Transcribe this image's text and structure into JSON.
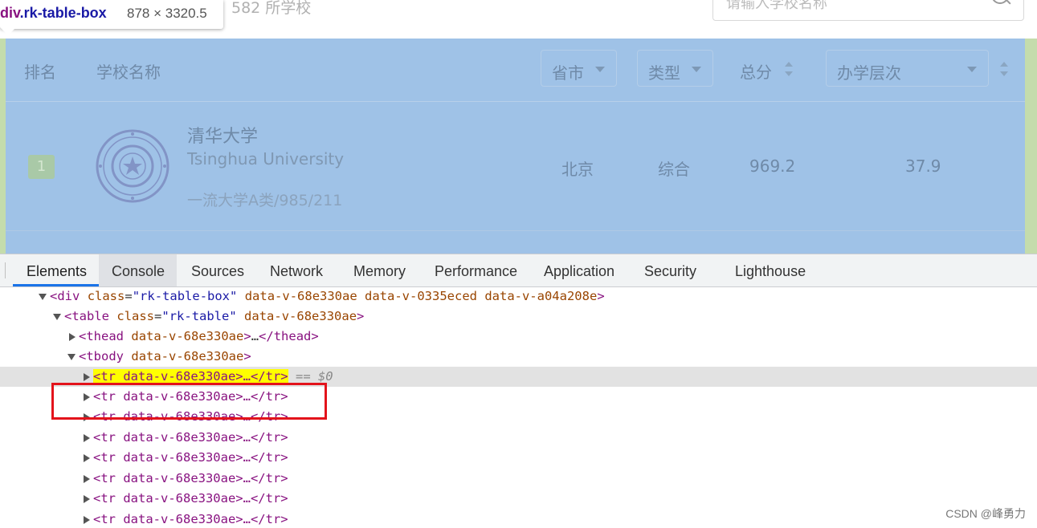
{
  "page": {
    "school_count": "582 所学校",
    "search_placeholder": "请输入学校名称",
    "tooltip": {
      "tag": "div",
      "class": ".rk-table-box",
      "size": "878 × 3320.5"
    },
    "headers": {
      "rank": "排名",
      "name": "学校名称",
      "province": "省市",
      "type": "类型",
      "score": "总分",
      "level": "办学层次"
    },
    "row": {
      "rank": "1",
      "name_cn": "清华大学",
      "name_en": "Tsinghua University",
      "tags": "一流大学A类/985/211",
      "province": "北京",
      "type": "综合",
      "score": "969.2",
      "level": "37.9"
    }
  },
  "devtools": {
    "tabs": [
      "Elements",
      "Console",
      "Sources",
      "Network",
      "Memory",
      "Performance",
      "Application",
      "Security",
      "Lighthouse"
    ],
    "tree": {
      "line1": {
        "tag": "div",
        "attr1_name": "class",
        "attr1_value": "\"rk-table-box\"",
        "rest": "data-v-68e330ae data-v-0335eced data-v-a04a208e"
      },
      "line2": {
        "tag": "table",
        "attr1_name": "class",
        "attr1_value": "\"rk-table\"",
        "rest": "data-v-68e330ae"
      },
      "line3": {
        "tag": "thead",
        "rest": "data-v-68e330ae",
        "close": "</thead>"
      },
      "line4": {
        "tag": "tbody",
        "rest": "data-v-68e330ae"
      },
      "selected_row": {
        "text": "<tr data-v-68e330ae>…</tr>",
        "suffix": "== $0"
      },
      "tr_text": "<tr data-v-68e330ae>…</tr>"
    }
  },
  "watermark": "CSDN @峰勇力",
  "colors": {
    "highlight_overlay": "#9fc2e7",
    "padding_overlay": "#c4dcac",
    "accent": "#1a73e8",
    "red_annotation": "#e3131b"
  }
}
